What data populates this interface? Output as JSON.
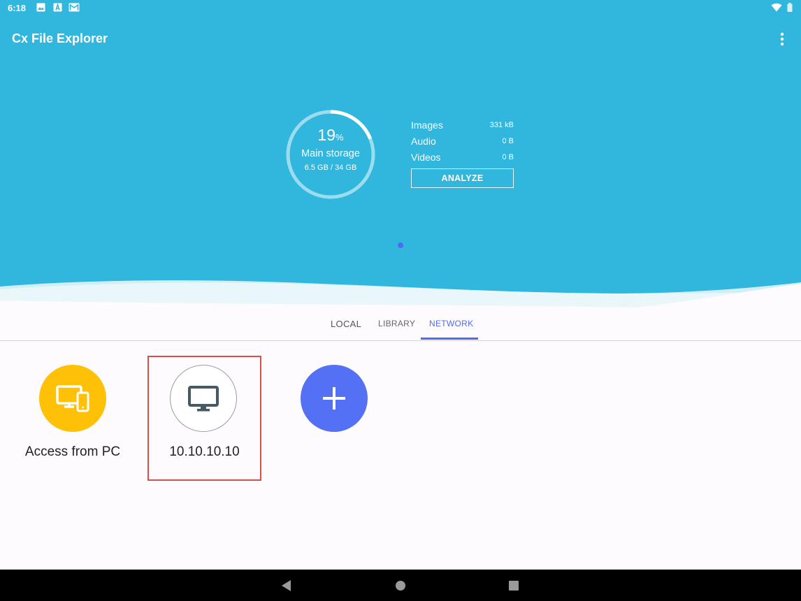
{
  "status_bar": {
    "time": "6:18",
    "icons": [
      "image-icon",
      "font-icon",
      "mail-icon",
      "wifi-icon",
      "battery-icon"
    ]
  },
  "app": {
    "title": "Cx File Explorer",
    "accent_color": "#31b6de",
    "tab_accent_color": "#4f6bf0"
  },
  "storage": {
    "percent": "19",
    "percent_sign": "%",
    "percent_value": 19,
    "name": "Main storage",
    "size": "6.5 GB / 34 GB",
    "categories": [
      {
        "label": "Images",
        "value": "331 kB"
      },
      {
        "label": "Audio",
        "value": "0 B"
      },
      {
        "label": "Videos",
        "value": "0 B"
      }
    ],
    "analyze_label": "ANALYZE"
  },
  "tabs": [
    {
      "label": "LOCAL",
      "active": false
    },
    {
      "label": "LIBRARY",
      "active": false
    },
    {
      "label": "NETWORK",
      "active": true
    }
  ],
  "network_items": [
    {
      "label": "Access from PC",
      "icon": "devices-icon",
      "color": "#ffc107"
    },
    {
      "label": "10.10.10.10",
      "icon": "monitor-icon",
      "color": "#ffffff"
    },
    {
      "label": "",
      "icon": "plus-icon",
      "color": "#5470f5"
    }
  ],
  "nav_bar": {
    "buttons": [
      "back-icon",
      "home-icon",
      "recents-icon"
    ]
  }
}
